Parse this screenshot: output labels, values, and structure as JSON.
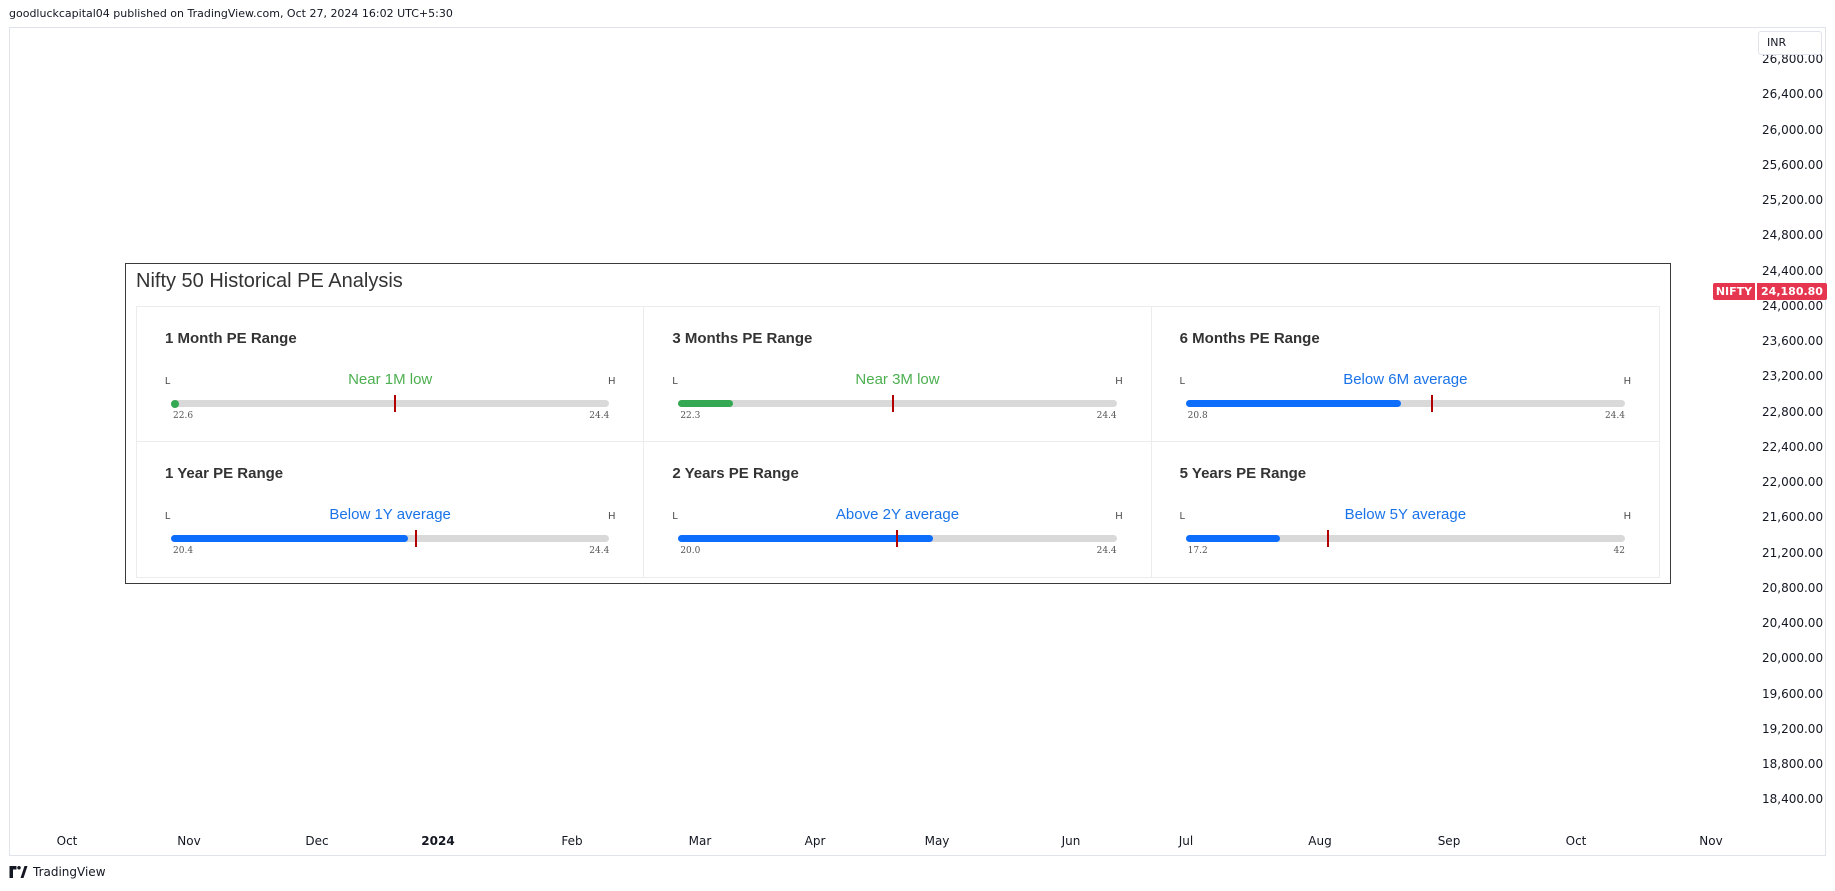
{
  "published": "goodluckcapital04 published on TradingView.com, Oct 27, 2024 16:02 UTC+5:30",
  "currency": "INR",
  "price_axis": {
    "labels": [
      "26,800.00",
      "26,400.00",
      "26,000.00",
      "25,600.00",
      "25,200.00",
      "24,800.00",
      "24,400.00",
      "24,000.00",
      "23,600.00",
      "23,200.00",
      "22,800.00",
      "22,400.00",
      "22,000.00",
      "21,600.00",
      "21,200.00",
      "20,800.00",
      "20,400.00",
      "20,000.00",
      "19,600.00",
      "19,200.00",
      "18,800.00",
      "18,400.00"
    ]
  },
  "last_price": {
    "symbol": "NIFTY",
    "value": "24,180.80"
  },
  "time_axis": {
    "labels": [
      "Oct",
      "Nov",
      "Dec",
      "2024",
      "Feb",
      "Mar",
      "Apr",
      "May",
      "Jun",
      "Jul",
      "Aug",
      "Sep",
      "Oct",
      "Nov"
    ]
  },
  "logo": {
    "text": "TradingView",
    "icon": "tradingview-logo-icon"
  },
  "panel": {
    "title": "Nifty 50 Historical PE Analysis",
    "low_marker": "L",
    "high_marker": "H",
    "colors": {
      "green": "#34a853",
      "blue": "#0d6efd",
      "green_text": "#4caf50",
      "blue_text": "#1a73e8",
      "track": "#d9d9d9",
      "marker": "#b20000"
    },
    "cards": [
      {
        "title": "1 Month PE Range",
        "status": "Near 1M low",
        "tone": "green",
        "low": "22.6",
        "high": "24.4",
        "current_fraction": 0.01,
        "average_fraction": 0.51
      },
      {
        "title": "3 Months PE Range",
        "status": "Near 3M low",
        "tone": "green",
        "low": "22.3",
        "high": "24.4",
        "current_fraction": 0.125,
        "average_fraction": 0.49
      },
      {
        "title": "6 Months PE Range",
        "status": "Below 6M average",
        "tone": "blue",
        "low": "20.8",
        "high": "24.4",
        "current_fraction": 0.49,
        "average_fraction": 0.56
      },
      {
        "title": "1 Year PE Range",
        "status": "Below 1Y average",
        "tone": "blue",
        "low": "20.4",
        "high": "24.4",
        "current_fraction": 0.54,
        "average_fraction": 0.56
      },
      {
        "title": "2 Years PE Range",
        "status": "Above 2Y average",
        "tone": "blue",
        "low": "20.0",
        "high": "24.4",
        "current_fraction": 0.58,
        "average_fraction": 0.5
      },
      {
        "title": "5 Years PE Range",
        "status": "Below 5Y average",
        "tone": "blue",
        "low": "17.2",
        "high": "42",
        "current_fraction": 0.215,
        "average_fraction": 0.325
      }
    ]
  }
}
